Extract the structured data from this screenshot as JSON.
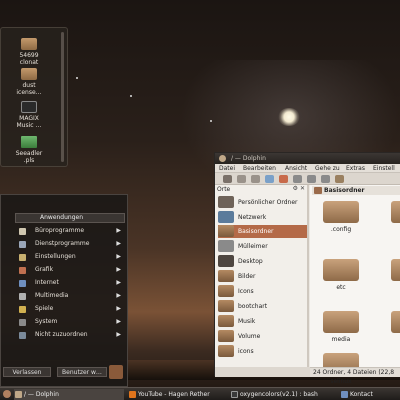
{
  "desktop": {
    "items": [
      {
        "line1": "54699",
        "line2": "clonat",
        "icon": "folder-icon"
      },
      {
        "line1": "dust",
        "line2": "icense…",
        "icon": "folder-icon"
      },
      {
        "line1": "MAGIX",
        "line2": "Music …",
        "icon": "magix-icon"
      },
      {
        "line1": "Seeadler",
        "line2": ".pls",
        "icon": "playlist-icon"
      }
    ]
  },
  "kmenu": {
    "header": "Anwendungen",
    "items": [
      {
        "label": "Büroprogramme",
        "color": "#d0c7b0"
      },
      {
        "label": "Dienstprogramme",
        "color": "#9aa6b8"
      },
      {
        "label": "Einstellungen",
        "color": "#c8b070"
      },
      {
        "label": "Grafik",
        "color": "#c07050"
      },
      {
        "label": "Internet",
        "color": "#6f8fbf"
      },
      {
        "label": "Multimedia",
        "color": "#b0b0b0"
      },
      {
        "label": "Spiele",
        "color": "#d0b050"
      },
      {
        "label": "System",
        "color": "#8a8a8a"
      },
      {
        "label": "Nicht zuzuordnen",
        "color": "#7a8a9a"
      }
    ],
    "logout": "Verlassen",
    "user": "Benutzer w…"
  },
  "taskbar": {
    "tasks": [
      {
        "label": "/ — Dolphin"
      },
      {
        "label": "YouTube - Hagen Rether"
      },
      {
        "label": "oxygencolors(v2.1) : bash"
      },
      {
        "label": "Kontact"
      }
    ]
  },
  "dolphin": {
    "title": "/ — Dolphin",
    "menu": [
      "Datei",
      "Bearbeiten",
      "Ansicht",
      "Gehe zu",
      "Extras",
      "Einstell"
    ],
    "places_label": "Orte",
    "places": [
      {
        "label": "Persönlicher Ordner",
        "icon": "home-icon"
      },
      {
        "label": "Netzwerk",
        "icon": "network-icon"
      },
      {
        "label": "Basisordner",
        "icon": "root-folder-icon",
        "active": true
      },
      {
        "label": "Mülleimer",
        "icon": "trash-icon"
      },
      {
        "label": "Desktop",
        "icon": "desktop-icon"
      },
      {
        "label": "Bilder",
        "icon": "folder-icon"
      },
      {
        "label": "Icons",
        "icon": "folder-icon"
      },
      {
        "label": "bootchart",
        "icon": "folder-icon"
      },
      {
        "label": "Musik",
        "icon": "folder-icon"
      },
      {
        "label": "Volume",
        "icon": "folder-icon"
      },
      {
        "label": "icons",
        "icon": "folder-icon"
      }
    ],
    "breadcrumb": "Basisordner",
    "folders": [
      ".config",
      "etc",
      "media",
      "selinux"
    ],
    "status": "24 Ordner, 4 Dateien (22,8"
  }
}
